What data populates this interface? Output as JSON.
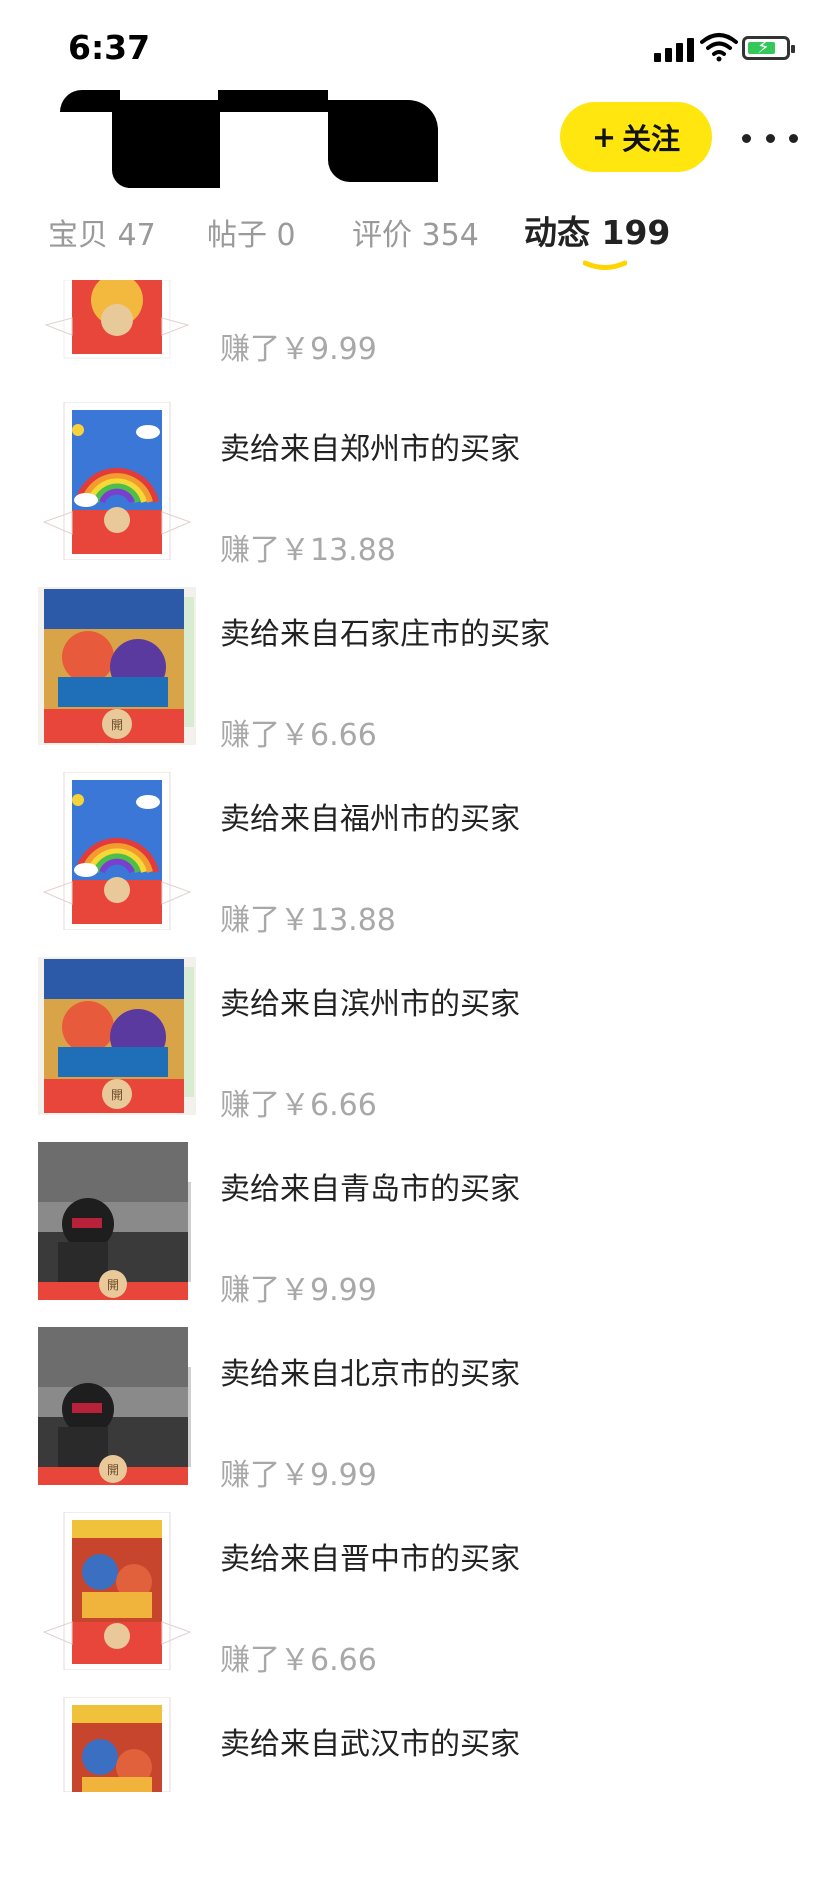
{
  "status_bar": {
    "time": "6:37"
  },
  "header": {
    "follow_label": "关注",
    "follow_plus": "+"
  },
  "tabs": [
    {
      "label": "宝贝 47"
    },
    {
      "label": "帖子 0"
    },
    {
      "label": "评价 354"
    },
    {
      "label": "动态 199",
      "active": true
    }
  ],
  "feed": [
    {
      "title": "",
      "earned": "赚了￥9.99",
      "thumb": "red-envelope-cover-gold"
    },
    {
      "title": "卖给来自郑州市的买家",
      "earned": "赚了￥13.88",
      "thumb": "red-envelope-cover-rainbow"
    },
    {
      "title": "卖给来自石家庄市的买家",
      "earned": "赚了￥6.66",
      "thumb": "red-envelope-cover-illustration"
    },
    {
      "title": "卖给来自福州市的买家",
      "earned": "赚了￥13.88",
      "thumb": "red-envelope-cover-rainbow"
    },
    {
      "title": "卖给来自滨州市的买家",
      "earned": "赚了￥6.66",
      "thumb": "red-envelope-cover-illustration"
    },
    {
      "title": "卖给来自青岛市的买家",
      "earned": "赚了￥9.99",
      "thumb": "red-envelope-cover-motorcyclist"
    },
    {
      "title": "卖给来自北京市的买家",
      "earned": "赚了￥9.99",
      "thumb": "red-envelope-cover-motorcyclist"
    },
    {
      "title": "卖给来自晋中市的买家",
      "earned": "赚了￥6.66",
      "thumb": "red-envelope-cover-small-illustration"
    },
    {
      "title": "卖给来自武汉市的买家",
      "earned": "",
      "thumb": "red-envelope-cover-small-illustration"
    }
  ]
}
